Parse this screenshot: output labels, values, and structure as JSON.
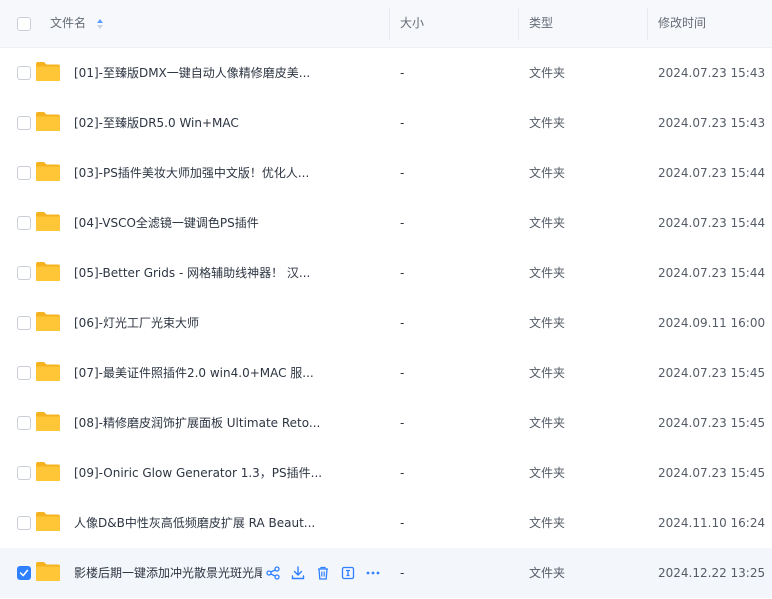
{
  "header": {
    "name": "文件名",
    "size": "大小",
    "type": "类型",
    "modified": "修改时间"
  },
  "rows": [
    {
      "name": "[01]-至臻版DMX一键自动人像精修磨皮美...",
      "size": "-",
      "type": "文件夹",
      "modified": "2024.07.23 15:43",
      "selected": false
    },
    {
      "name": "[02]-至臻版DR5.0 Win+MAC",
      "size": "-",
      "type": "文件夹",
      "modified": "2024.07.23 15:43",
      "selected": false
    },
    {
      "name": "[03]-PS插件美妆大师加强中文版！优化人...",
      "size": "-",
      "type": "文件夹",
      "modified": "2024.07.23 15:44",
      "selected": false
    },
    {
      "name": "[04]-VSCO全滤镜一键调色PS插件",
      "size": "-",
      "type": "文件夹",
      "modified": "2024.07.23 15:44",
      "selected": false
    },
    {
      "name": "[05]-Better Grids - 网格辅助线神器！ 汉...",
      "size": "-",
      "type": "文件夹",
      "modified": "2024.07.23 15:44",
      "selected": false
    },
    {
      "name": "[06]-灯光工厂光束大师",
      "size": "-",
      "type": "文件夹",
      "modified": "2024.09.11 16:00",
      "selected": false
    },
    {
      "name": "[07]-最美证件照插件2.0 win4.0+MAC 服...",
      "size": "-",
      "type": "文件夹",
      "modified": "2024.07.23 15:45",
      "selected": false
    },
    {
      "name": "[08]-精修磨皮润饰扩展面板 Ultimate Reto...",
      "size": "-",
      "type": "文件夹",
      "modified": "2024.07.23 15:45",
      "selected": false
    },
    {
      "name": "[09]-Oniric Glow Generator 1.3，PS插件...",
      "size": "-",
      "type": "文件夹",
      "modified": "2024.07.23 15:45",
      "selected": false
    },
    {
      "name": "人像D&B中性灰高低频磨皮扩展 RA Beaut...",
      "size": "-",
      "type": "文件夹",
      "modified": "2024.11.10 16:24",
      "selected": false
    },
    {
      "name": "影楼后期一键添加冲光散景光斑光尾",
      "size": "-",
      "type": "文件夹",
      "modified": "2024.12.22 13:25",
      "selected": true
    }
  ],
  "icons": {
    "folder": "folder-icon",
    "share": "share-icon",
    "download": "download-icon",
    "delete": "trash-icon",
    "rename": "rename-icon",
    "more": "more-icon",
    "sort": "sort-icon"
  },
  "colors": {
    "accent": "#2f80ff",
    "folder": "#ffc637",
    "folder_back": "#f5b320",
    "selected_row": "#f3f6fb",
    "header_bg": "#f7f8fb"
  }
}
